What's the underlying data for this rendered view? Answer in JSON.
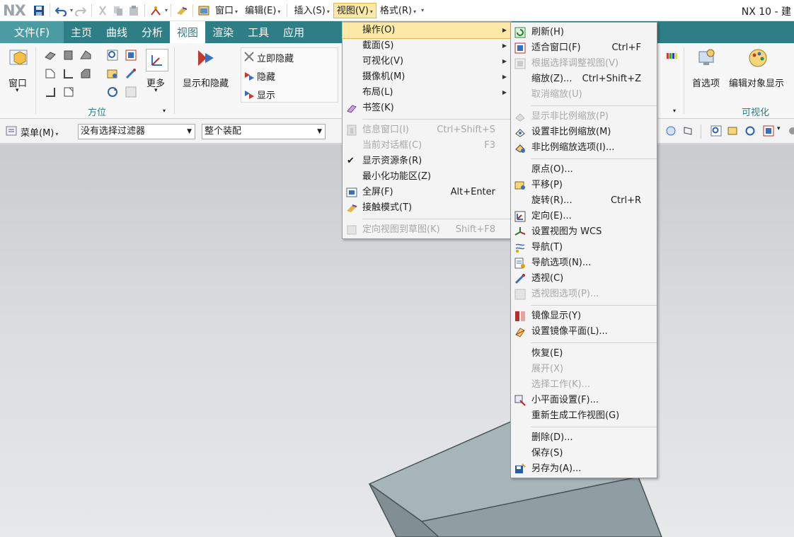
{
  "titlebar": {
    "logo": "NX",
    "menus": [
      {
        "label": "窗口"
      },
      {
        "label": "编辑(E)"
      },
      {
        "label": "插入(S)"
      },
      {
        "label": "视图(V)"
      },
      {
        "label": "格式(R)"
      }
    ],
    "app_title": "NX 10 - 建"
  },
  "tabs": [
    "文件(F)",
    "主页",
    "曲线",
    "分析",
    "视图",
    "渲染",
    "工具",
    "应用"
  ],
  "ribbon": {
    "window_label": "窗口",
    "orient_group_label": "方位",
    "more_label": "更多",
    "show_hide_label": "显示和隐藏",
    "hide_immediate_label": "立即隐藏",
    "hide_label": "隐藏",
    "show_label": "显示",
    "prefs_label": "首选项",
    "edit_object_display_label": "编辑对象显示",
    "visualization_group_label": "可视化"
  },
  "selbar": {
    "menu_label": "菜单(M)",
    "filter_value": "没有选择过滤器",
    "scope_value": "整个装配"
  },
  "view_menu": [
    {
      "label": "操作(O)",
      "submenu": true,
      "highlight": true,
      "icon": ""
    },
    {
      "label": "截面(S)",
      "submenu": true,
      "icon": ""
    },
    {
      "label": "可视化(V)",
      "submenu": true,
      "icon": ""
    },
    {
      "label": "摄像机(M)",
      "submenu": true,
      "icon": ""
    },
    {
      "label": "布局(L)",
      "submenu": true,
      "icon": ""
    },
    {
      "label": "书签(K)",
      "icon": "bookmark-icon"
    },
    {
      "sep": true
    },
    {
      "label": "信息窗口(I)",
      "shortcut": "Ctrl+Shift+S",
      "disabled": true,
      "icon": "info-icon"
    },
    {
      "label": "当前对话框(C)",
      "shortcut": "F3",
      "disabled": true,
      "icon": ""
    },
    {
      "label": "显示资源条(R)",
      "checked": true,
      "icon": ""
    },
    {
      "label": "最小化功能区(Z)",
      "icon": ""
    },
    {
      "label": "全屏(F)",
      "shortcut": "Alt+Enter",
      "icon": "fullscreen-icon"
    },
    {
      "label": "接触模式(T)",
      "icon": "touch-mode-icon"
    },
    {
      "sep": true
    },
    {
      "label": "定向视图到草图(K)",
      "shortcut": "Shift+F8",
      "disabled": true,
      "icon": "orient-sketch-icon"
    }
  ],
  "operation_submenu": [
    {
      "label": "刷新(H)",
      "icon": "refresh-icon"
    },
    {
      "label": "适合窗口(F)",
      "shortcut": "Ctrl+F",
      "icon": "fit-window-icon"
    },
    {
      "label": "根据选择调整视图(V)",
      "disabled": true,
      "icon": "fit-selection-icon"
    },
    {
      "label": "缩放(Z)...",
      "shortcut": "Ctrl+Shift+Z",
      "icon": ""
    },
    {
      "label": "取消缩放(U)",
      "disabled": true,
      "icon": ""
    },
    {
      "sep": true
    },
    {
      "label": "显示非比例缩放(P)",
      "disabled": true,
      "icon": "show-nonuniform-scale-icon"
    },
    {
      "label": "设置非比例缩放(M)",
      "icon": "set-nonuniform-scale-icon"
    },
    {
      "label": "非比例缩放选项(I)...",
      "icon": "nonuniform-scale-options-icon"
    },
    {
      "sep": true
    },
    {
      "label": "原点(O)...",
      "icon": ""
    },
    {
      "label": "平移(P)",
      "icon": "pan-icon"
    },
    {
      "label": "旋转(R)...",
      "shortcut": "Ctrl+R",
      "icon": ""
    },
    {
      "label": "定向(E)...",
      "icon": "orient-icon"
    },
    {
      "label": "设置视图为 WCS",
      "icon": "set-view-wcs-icon"
    },
    {
      "label": "导航(T)",
      "icon": "navigate-icon"
    },
    {
      "label": "导航选项(N)...",
      "icon": "navigate-options-icon"
    },
    {
      "label": "透视(C)",
      "icon": "perspective-icon"
    },
    {
      "label": "透视图选项(P)...",
      "disabled": true,
      "icon": "perspective-options-icon"
    },
    {
      "sep": true
    },
    {
      "label": "镜像显示(Y)",
      "icon": "mirror-display-icon"
    },
    {
      "label": "设置镜像平面(L)...",
      "icon": "mirror-plane-icon"
    },
    {
      "sep": true
    },
    {
      "label": "恢复(E)",
      "icon": ""
    },
    {
      "label": "展开(X)",
      "disabled": true,
      "icon": ""
    },
    {
      "label": "选择工作(K)...",
      "disabled": true,
      "icon": ""
    },
    {
      "label": "小平面设置(F)...",
      "icon": "facet-settings-icon"
    },
    {
      "label": "重新生成工作视图(G)",
      "icon": ""
    },
    {
      "sep": true
    },
    {
      "label": "删除(D)...",
      "icon": ""
    },
    {
      "label": "保存(S)",
      "icon": ""
    },
    {
      "label": "另存为(A)...",
      "icon": "save-as-icon"
    }
  ]
}
